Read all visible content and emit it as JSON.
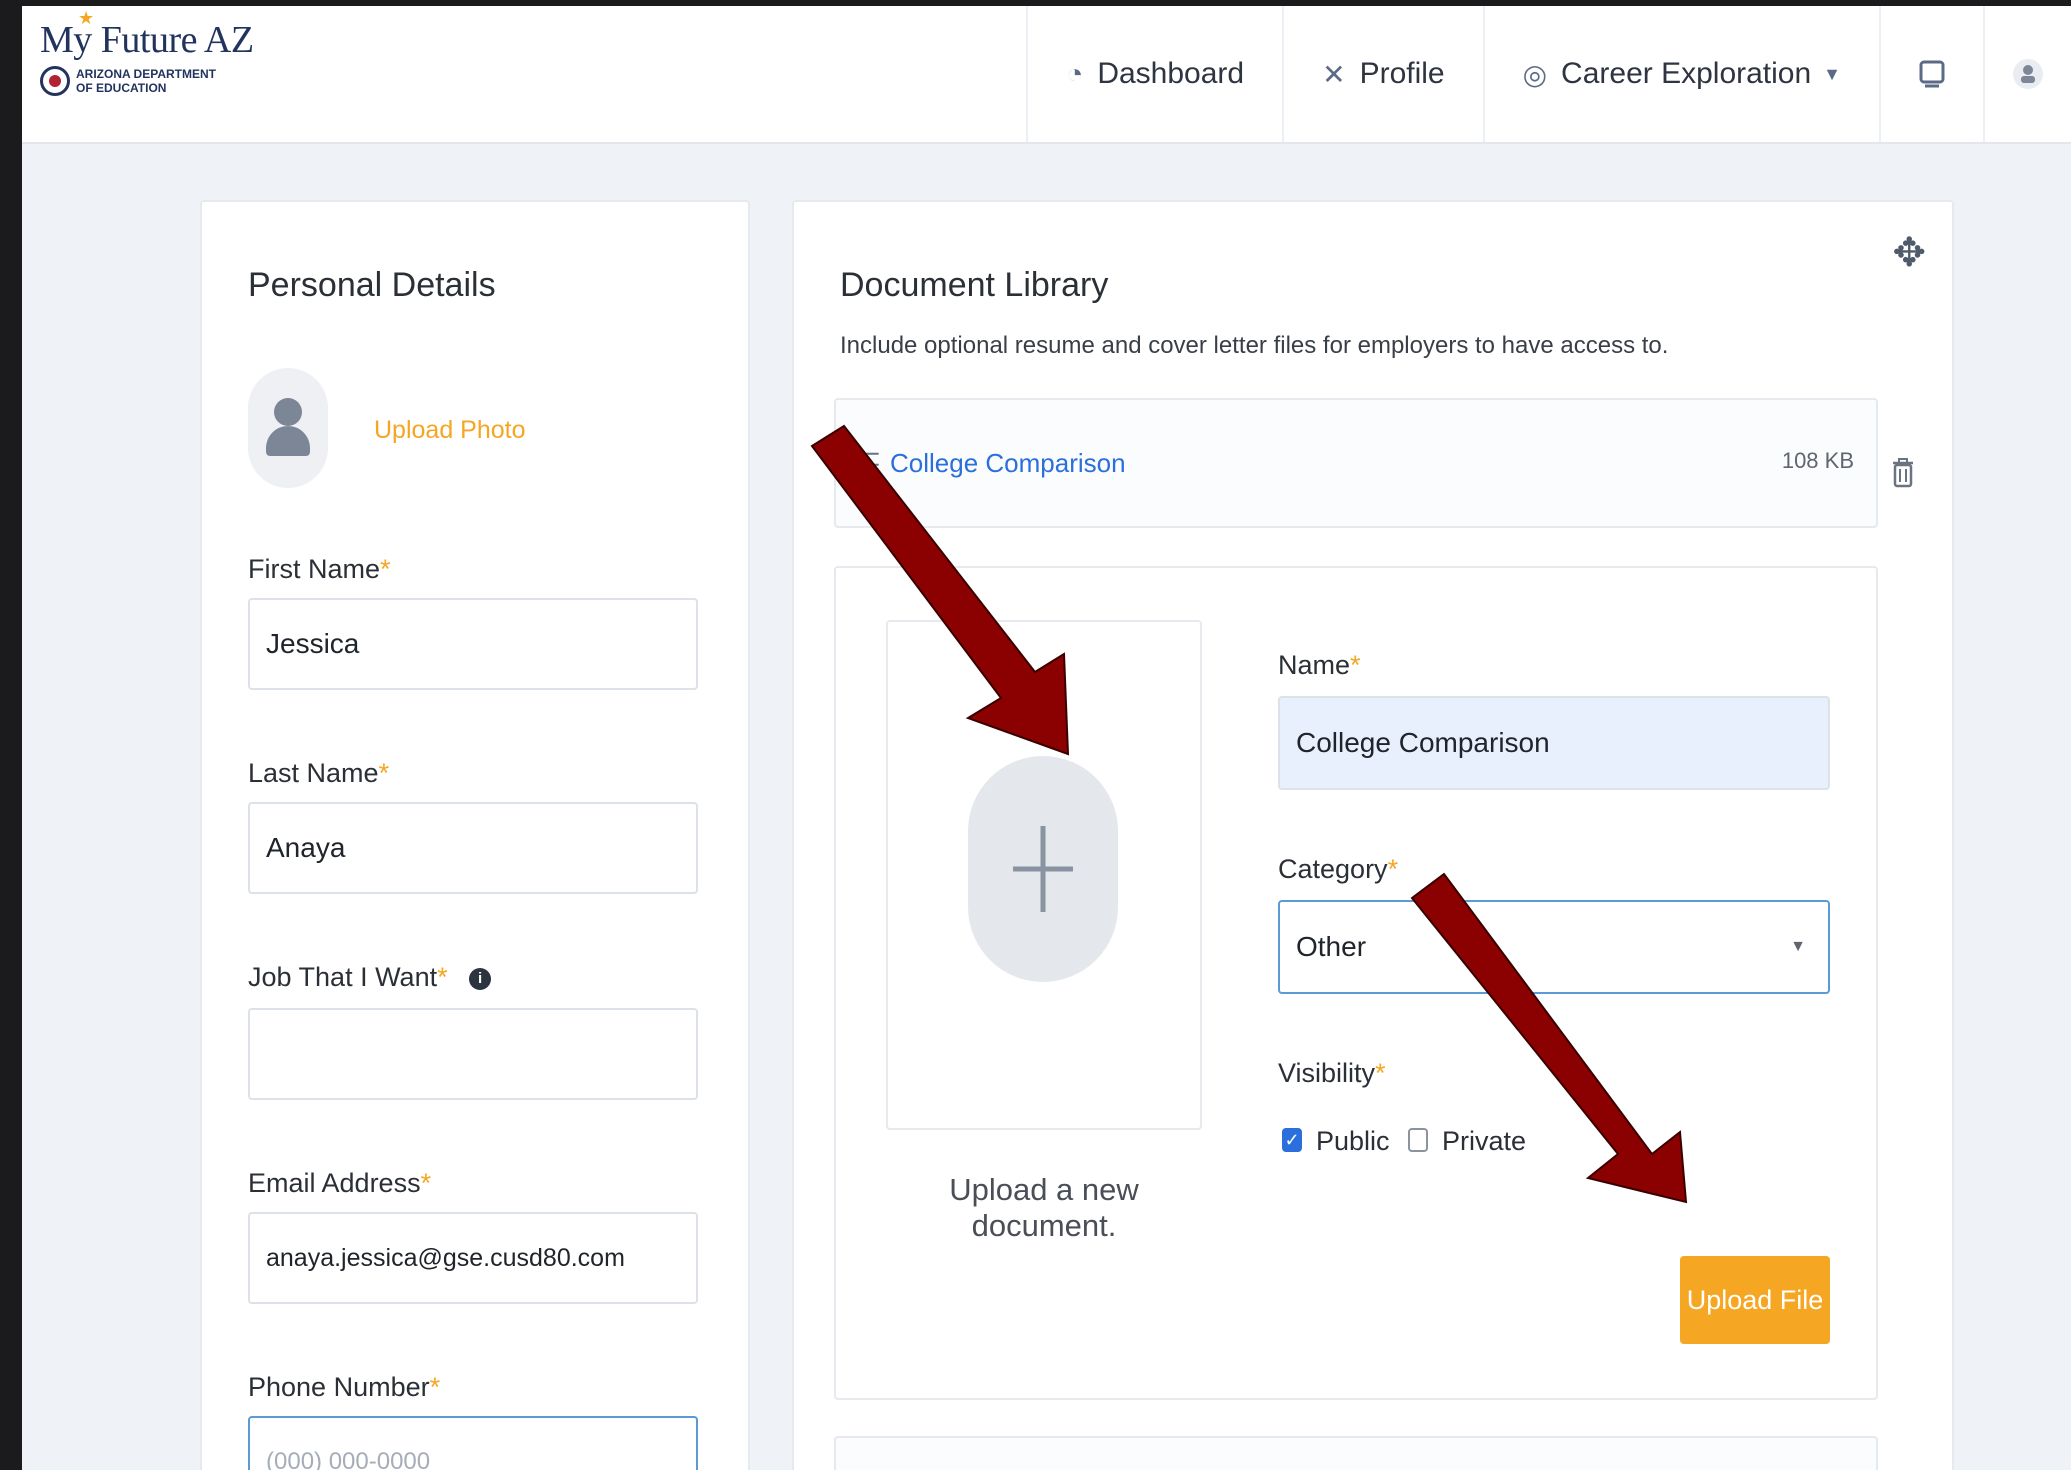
{
  "logo": {
    "title": "My Future AZ",
    "department": "ARIZONA DEPARTMENT OF EDUCATION"
  },
  "nav": {
    "items": [
      {
        "label": "Dashboard",
        "icon": "dashboard-icon"
      },
      {
        "label": "Profile",
        "icon": "tools-icon"
      },
      {
        "label": "Career Exploration",
        "icon": "compass-icon"
      }
    ]
  },
  "personal": {
    "title": "Personal Details",
    "upload_photo": "Upload Photo",
    "first_name_label": "First Name",
    "first_name_value": "Jessica",
    "last_name_label": "Last Name",
    "last_name_value": "Anaya",
    "job_label": "Job That I Want",
    "job_value": "",
    "email_label": "Email Address",
    "email_value": "anaya.jessica@gse.cusd80.com",
    "phone_label": "Phone Number",
    "phone_placeholder": "(000) 000-0000"
  },
  "library": {
    "title": "Document Library",
    "description": "Include optional resume and cover letter files for employers to have access to.",
    "document": {
      "name": "College Comparison",
      "size": "108 KB"
    },
    "upload_text": "Upload a new document.",
    "name_label": "Name",
    "name_value": "College Comparison",
    "category_label": "Category",
    "category_value": "Other",
    "visibility_label": "Visibility",
    "public_label": "Public",
    "private_label": "Private",
    "public_checked": true,
    "private_checked": false,
    "upload_button": "Upload File"
  },
  "colors": {
    "accent": "#f5a623",
    "link": "#2a6fdb",
    "annotation_arrow": "#8b0000"
  }
}
